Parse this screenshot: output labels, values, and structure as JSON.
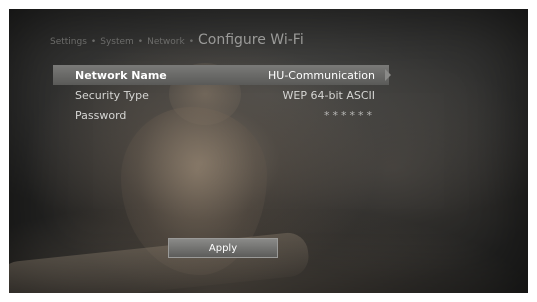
{
  "breadcrumb": {
    "items": [
      "Settings",
      "System",
      "Network"
    ],
    "separator": "•",
    "title": "Configure Wi-Fi"
  },
  "settings": {
    "rows": [
      {
        "label": "Network Name",
        "value": "HU-Communication"
      },
      {
        "label": "Security Type",
        "value": "WEP 64-bit ASCII"
      },
      {
        "label": "Password",
        "value": "******"
      }
    ],
    "selected_index": 0
  },
  "apply_label": "Apply",
  "colors": {
    "selected_row": "#6a6a68",
    "button": "#757573",
    "background": "#2e2e2d"
  }
}
